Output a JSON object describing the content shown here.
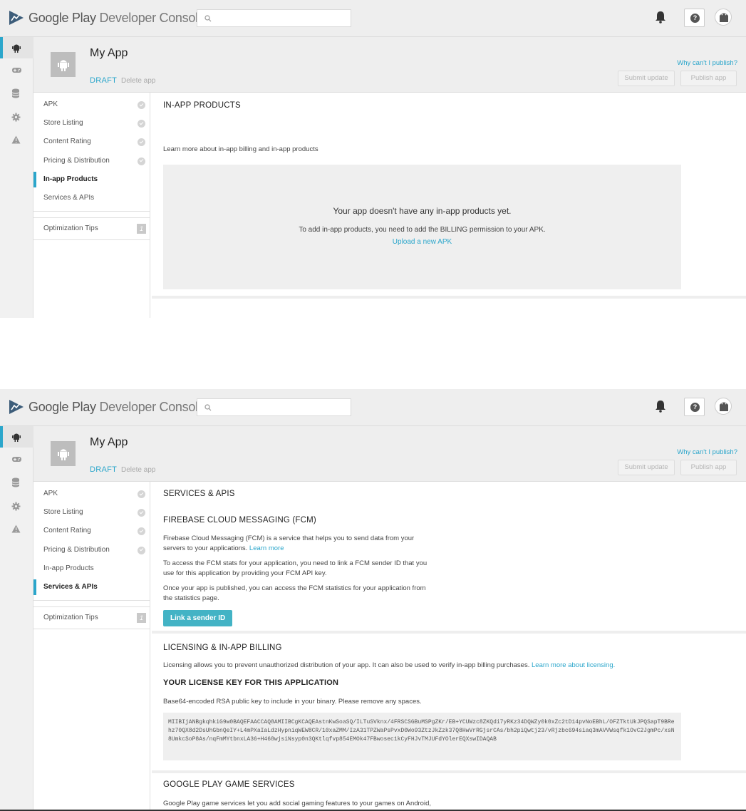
{
  "topbar": {
    "brand_google_play": "Google Play",
    "brand_developer_console": "Developer Console",
    "search_placeholder": "",
    "icons": [
      "play-console-logo-icon",
      "search-icon",
      "bell-icon",
      "help-icon",
      "avatar-icon"
    ]
  },
  "rail": {
    "items": [
      "android-icon",
      "gamepad-icon",
      "database-icon",
      "gear-icon",
      "warning-icon"
    ]
  },
  "app_header": {
    "title": "My App",
    "status": "DRAFT",
    "delete_label": "Delete app",
    "why_cant_publish": "Why can't I publish?",
    "submit_update": "Submit update",
    "publish_app": "Publish app"
  },
  "nav": {
    "apk": "APK",
    "store_listing": "Store Listing",
    "content_rating": "Content Rating",
    "pricing_distribution": "Pricing & Distribution",
    "in_app_products": "In-app Products",
    "services_apis": "Services & APIs",
    "optimization_tips": "Optimization Tips",
    "optimization_count": "1"
  },
  "inapp": {
    "heading": "IN-APP PRODUCTS",
    "learn_more": "Learn more about in-app billing and in-app products",
    "empty_title": "Your app doesn't have any in-app products yet.",
    "empty_desc": "To add in-app products, you need to add the BILLING permission to your APK.",
    "upload_link": "Upload a new APK"
  },
  "services": {
    "heading": "SERVICES & APIS",
    "fcm": {
      "heading": "FIREBASE CLOUD MESSAGING (FCM)",
      "p1": "Firebase Cloud Messaging (FCM) is a service that helps you to send data from your servers to your applications.",
      "p1_link": "Learn more",
      "p2": "To access the FCM stats for your application, you need to link a FCM sender ID that you use for this application by providing your FCM API key.",
      "p3": "Once your app is published, you can access the FCM statistics for your application from the statistics page.",
      "button": "Link a sender ID"
    },
    "licensing": {
      "heading": "LICENSING & IN-APP BILLING",
      "p1": "Licensing allows you to prevent unauthorized distribution of your app. It can also be used to verify in-app billing purchases.",
      "p1_link": "Learn more about licensing.",
      "key_heading": "YOUR LICENSE KEY FOR THIS APPLICATION",
      "key_desc": "Base64-encoded RSA public key to include in your binary. Please remove any spaces.",
      "key_value": "MIIBIjANBgkqhkiG9w0BAQEFAACCAQ8AMIIBCgKCAQEAstnKwSoaSQ/ILTuSVknx/4FRSCSGBuMSPgZKr/EB+YCUWzc8ZKQdi7yRKz34DQWZy0k0xZc2tD14pvNoEBhL/OFZTktUkJPQSapT9BRehz70QX8d2DsUhGbnQeIY+L4mPXaIaLdzHypniqWEW8CR/10xaZMM/IzA31TPZWaPsPvxD0Wo93ZtzJkZzk37Q8HwVrRGjsrCAs/bh2piQwtj23/vRjzbc694siaq3mAVVWsqfk1OvC2JgmPc/xsN8UmkcSoP8As/nqFmMYtbnxLA36+H468wjsiNsyp0n3QKtlqfvp854EMOk47FBwosec1kCyFHJvTMJUFdYOlerEQXswIDAQAB"
    },
    "games": {
      "heading": "GOOGLE PLAY GAME SERVICES",
      "p1": "Google Play game services let you add social gaming features to your games on Android, iOS and the web. Users can be matched with opponents in their Google+ Circles, view"
    }
  },
  "colors": {
    "accent": "#2ba6cb",
    "button": "#43b3c5",
    "chrome_bg": "#eeeeee"
  }
}
